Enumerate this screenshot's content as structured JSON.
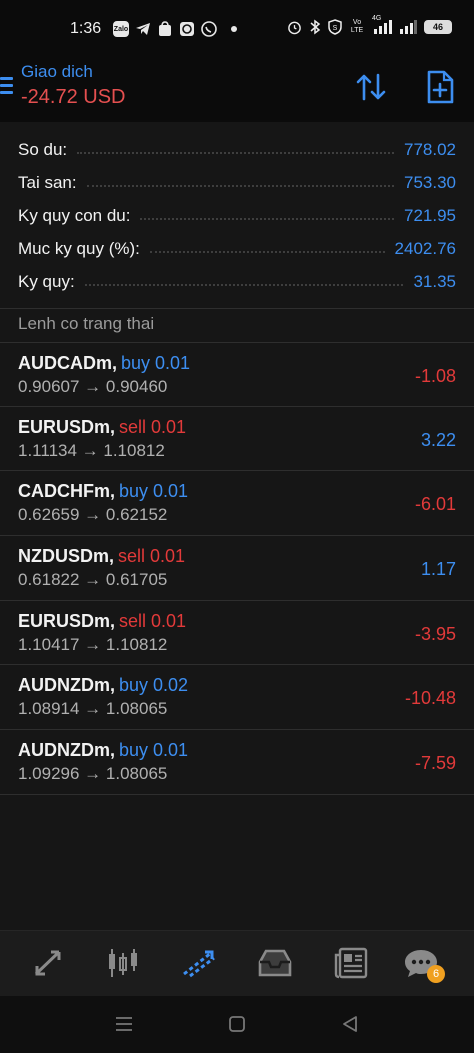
{
  "status_bar": {
    "time": "1:36",
    "left_icons": [
      "zalo-icon",
      "telegram-icon",
      "shopee-icon",
      "sync-icon",
      "whatsapp-icon",
      "dot-icon"
    ],
    "right_icons": [
      "alarm-icon",
      "bluetooth-icon",
      "vpn-icon",
      "volte-icon",
      "signal-4g-icon",
      "signal-icon"
    ],
    "battery": "46",
    "app_labels": {
      "zalo": "Zalo",
      "volte": "Vo LTE",
      "net": "4G"
    }
  },
  "header": {
    "title": "Giao dich",
    "subtitle": "-24.72 USD"
  },
  "account": [
    {
      "label": "So du:",
      "value": "778.02"
    },
    {
      "label": "Tai san:",
      "value": "753.30"
    },
    {
      "label": "Ky quy con du:",
      "value": "721.95"
    },
    {
      "label": "Muc ky quy (%):",
      "value": "2402.76"
    },
    {
      "label": "Ky quy:",
      "value": "31.35"
    }
  ],
  "section_title": "Lenh co trang thai",
  "orders": [
    {
      "symbol": "AUDCADm,",
      "side": "buy 0.01",
      "side_type": "buy",
      "price": "0.90607 → 0.90460",
      "profit": "-1.08",
      "profit_type": "neg"
    },
    {
      "symbol": "EURUSDm,",
      "side": "sell 0.01",
      "side_type": "sell",
      "price": "1.11134 → 1.10812",
      "profit": "3.22",
      "profit_type": "pos"
    },
    {
      "symbol": "CADCHFm,",
      "side": "buy 0.01",
      "side_type": "buy",
      "price": "0.62659 → 0.62152",
      "profit": "-6.01",
      "profit_type": "neg"
    },
    {
      "symbol": "NZDUSDm,",
      "side": "sell 0.01",
      "side_type": "sell",
      "price": "0.61822 → 0.61705",
      "profit": "1.17",
      "profit_type": "pos"
    },
    {
      "symbol": "EURUSDm,",
      "side": "sell 0.01",
      "side_type": "sell",
      "price": "1.10417 → 1.10812",
      "profit": "-3.95",
      "profit_type": "neg"
    },
    {
      "symbol": "AUDNZDm,",
      "side": "buy 0.02",
      "side_type": "buy",
      "price": "1.08914 → 1.08065",
      "profit": "-10.48",
      "profit_type": "neg"
    },
    {
      "symbol": "AUDNZDm,",
      "side": "buy 0.01",
      "side_type": "buy",
      "price": "1.09296 → 1.08065",
      "profit": "-7.59",
      "profit_type": "neg"
    }
  ],
  "bottom_nav": {
    "items": [
      "quotes-icon",
      "chart-icon",
      "trade-icon",
      "history-icon",
      "news-icon",
      "chat-icon"
    ],
    "active": "trade-icon",
    "chat_badge": "6"
  },
  "system_nav": [
    "recent-apps-icon",
    "home-icon",
    "back-icon"
  ],
  "colors": {
    "accent": "#3d8ef0",
    "negative": "#e23a3a",
    "header_loss": "#e55050",
    "background": "#161616",
    "badge": "#f0a020"
  }
}
